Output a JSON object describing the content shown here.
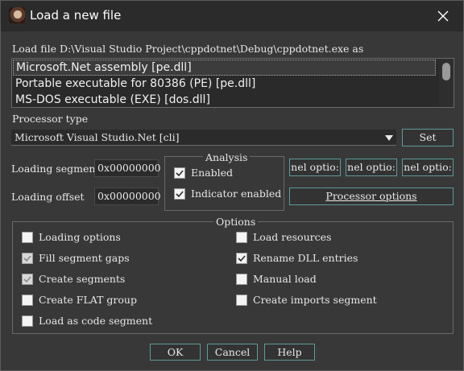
{
  "window": {
    "title": "Load a new file"
  },
  "load_file_label": "Load file D:\\Visual Studio Project\\cppdotnet\\Debug\\cppdotnet.exe as",
  "formats": [
    "Microsoft.Net assembly [pe.dll]",
    "Portable executable for 80386 (PE) [pe.dll]",
    "MS-DOS executable (EXE) [dos.dll]"
  ],
  "processor": {
    "label": "Processor type",
    "value": "Microsoft Visual Studio.Net [cli]",
    "set_button": "Set"
  },
  "loading_segment": {
    "label": "Loading segment",
    "value": "0x00000000"
  },
  "loading_offset": {
    "label": "Loading offset",
    "value": "0x00000000"
  },
  "analysis": {
    "title": "Analysis",
    "enabled": {
      "label": "Enabled",
      "checked": true
    },
    "indicator": {
      "label": "Indicator enabled",
      "checked": true
    }
  },
  "kernel_buttons": [
    "nel optio:",
    "nel optio:",
    "nel optio:"
  ],
  "processor_options_button": "Processor options",
  "options": {
    "title": "Options",
    "left": [
      {
        "label": "Loading options",
        "checked": false,
        "disabled": false
      },
      {
        "label": "Fill segment gaps",
        "checked": true,
        "disabled": true
      },
      {
        "label": "Create segments",
        "checked": true,
        "disabled": true
      },
      {
        "label": "Create FLAT group",
        "checked": false,
        "disabled": false
      },
      {
        "label": "Load as code segment",
        "checked": false,
        "disabled": false
      }
    ],
    "right": [
      {
        "label": "Load resources",
        "checked": false,
        "disabled": false
      },
      {
        "label": "Rename DLL entries",
        "checked": true,
        "disabled": false
      },
      {
        "label": "Manual load",
        "checked": false,
        "disabled": false
      },
      {
        "label": "Create imports segment",
        "checked": false,
        "disabled": false
      }
    ]
  },
  "buttons": {
    "ok": "OK",
    "cancel": "Cancel",
    "help": "Help"
  }
}
